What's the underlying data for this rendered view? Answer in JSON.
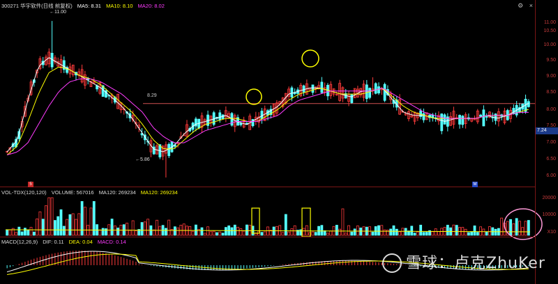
{
  "header": {
    "stock": "300271 华宇软件(日线 前复权)",
    "ma5": "MA5: 8.31",
    "ma10": "MA10: 8.10",
    "ma20": "MA20: 8.02"
  },
  "volume_header": {
    "indicator": "VOL-TDX(120,120)",
    "volume": "VOLUME: 567016",
    "ma120a": "MA120: 269234",
    "ma120b": "MA120: 269234"
  },
  "macd_header": {
    "indicator": "MACD(12,26,9)",
    "dif": "DIF: 0.11",
    "dea": "DEA: 0.04",
    "macd": "MACD: 0.14"
  },
  "price_axis": [
    "11.00",
    "10.50",
    "10.00",
    "9.50",
    "9.00",
    "8.50",
    "8.00",
    "7.50",
    "7.00",
    "6.50",
    "6.00"
  ],
  "volume_axis": [
    "20000",
    "10000",
    "X10"
  ],
  "annotations": {
    "high": "11.00",
    "low": "5.86",
    "level": "8.29",
    "current_price": "7.24"
  },
  "markers": {
    "m1": "5",
    "m2": "M"
  },
  "watermark": "雪球：卢克ZhuKer",
  "colors": {
    "up": "#ff3b3b",
    "down": "#54ffff",
    "ma5": "#ffffff",
    "ma10": "#ffff00",
    "ma20": "#ff3cff",
    "axis": "#c83c3c",
    "tag": "#1b3a8a"
  },
  "chart_data": {
    "type": "candlestick",
    "ylim": [
      5.7,
      11.3
    ],
    "level_line": 8.29,
    "series": [
      {
        "name": "MA5",
        "values": [
          6.7,
          7.1,
          8.4,
          9.5,
          9.8,
          9.6,
          9.4,
          9.2,
          9.0,
          8.8,
          8.5,
          8.2,
          7.8,
          7.3,
          6.8,
          6.7,
          6.9,
          7.3,
          7.6,
          7.7,
          7.8,
          7.9,
          7.7,
          7.6,
          7.8,
          8.0,
          8.2,
          8.6,
          8.7,
          8.8,
          8.8,
          8.7,
          8.6,
          8.5,
          8.7,
          8.7,
          8.8,
          8.4,
          8.0,
          7.9,
          7.9,
          7.8,
          7.7,
          7.8,
          7.8,
          7.8,
          7.9,
          7.8,
          7.9,
          8.1,
          8.3
        ]
      },
      {
        "name": "MA10",
        "values": [
          6.6,
          6.9,
          7.7,
          8.6,
          9.3,
          9.5,
          9.4,
          9.2,
          9.1,
          8.9,
          8.6,
          8.3,
          8.0,
          7.6,
          7.1,
          6.8,
          6.8,
          7.1,
          7.4,
          7.6,
          7.7,
          7.8,
          7.8,
          7.7,
          7.7,
          7.9,
          8.1,
          8.4,
          8.6,
          8.7,
          8.8,
          8.7,
          8.6,
          8.6,
          8.6,
          8.7,
          8.8,
          8.5,
          8.2,
          8.0,
          7.9,
          7.8,
          7.8,
          7.8,
          7.8,
          7.8,
          7.9,
          7.9,
          7.9,
          8.0,
          8.1
        ]
      },
      {
        "name": "MA20",
        "values": [
          6.6,
          6.7,
          7.0,
          7.6,
          8.2,
          8.7,
          9.0,
          9.1,
          9.1,
          9.0,
          8.8,
          8.6,
          8.3,
          8.0,
          7.5,
          7.2,
          7.0,
          7.0,
          7.2,
          7.4,
          7.5,
          7.6,
          7.7,
          7.7,
          7.7,
          7.8,
          7.9,
          8.2,
          8.4,
          8.5,
          8.6,
          8.7,
          8.7,
          8.7,
          8.7,
          8.7,
          8.8,
          8.6,
          8.4,
          8.2,
          8.0,
          7.9,
          7.8,
          7.8,
          7.8,
          7.8,
          7.9,
          7.9,
          7.9,
          8.0,
          8.0
        ]
      }
    ]
  }
}
